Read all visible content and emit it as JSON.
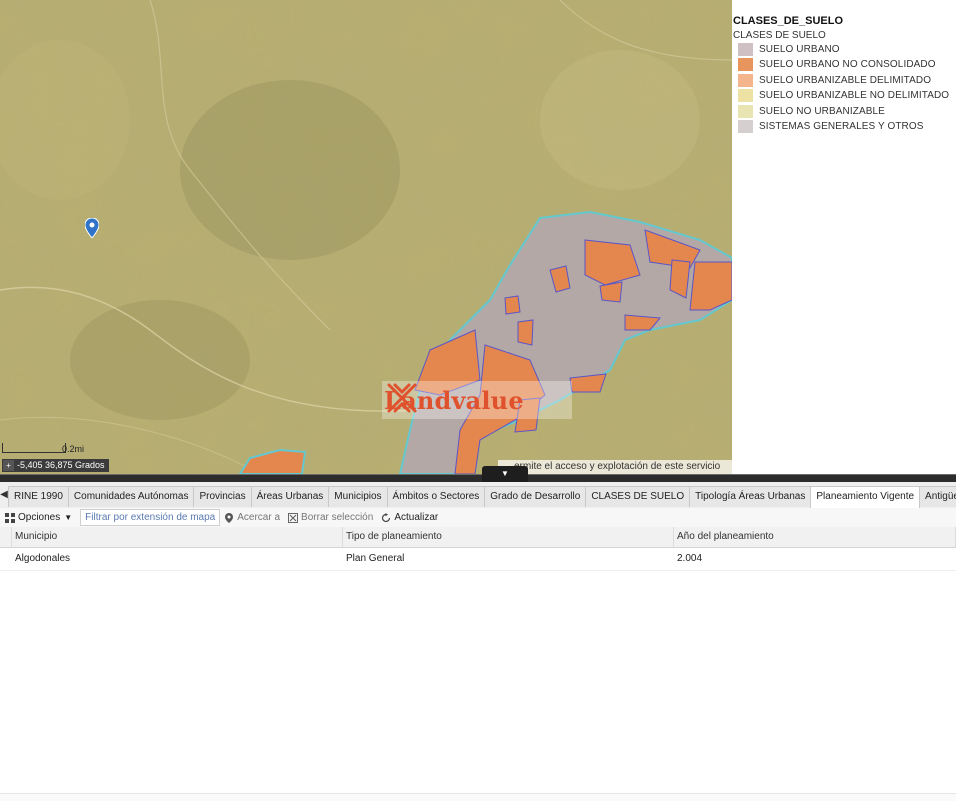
{
  "legend": {
    "title": "CLASES_DE_SUELO",
    "subtitle": "CLASES DE SUELO",
    "items": [
      {
        "label": "SUELO URBANO",
        "color": "#cfc0c4"
      },
      {
        "label": "SUELO URBANO NO CONSOLIDADO",
        "color": "#e8955d"
      },
      {
        "label": "SUELO URBANIZABLE DELIMITADO",
        "color": "#f4b48c"
      },
      {
        "label": "SUELO URBANIZABLE NO DELIMITADO",
        "color": "#ede1a4"
      },
      {
        "label": "SUELO NO URBANIZABLE",
        "color": "#e9e5b2"
      },
      {
        "label": "SISTEMAS GENERALES Y OTROS",
        "color": "#d6cfcf"
      }
    ]
  },
  "map": {
    "scale_label": "0.2mi",
    "coordinates": "-5,405 36,875 Grados",
    "attribution": "ermite el acceso y explotación de este servicio",
    "logo_text": "Landvalue",
    "colors": {
      "base": "#b5ab6c",
      "urban": "#b6a8a8",
      "orange": "#e08a55",
      "outline": "#64c8cf",
      "pin": "#2f74c9"
    }
  },
  "tabs": {
    "items": [
      {
        "label": "RINE 1990",
        "active": false
      },
      {
        "label": "Comunidades Autónomas",
        "active": false
      },
      {
        "label": "Provincias",
        "active": false
      },
      {
        "label": "Áreas Urbanas",
        "active": false
      },
      {
        "label": "Municipios",
        "active": false
      },
      {
        "label": "Ámbitos o Sectores",
        "active": false
      },
      {
        "label": "Grado de Desarrollo",
        "active": false
      },
      {
        "label": "CLASES DE SUELO",
        "active": false
      },
      {
        "label": "Tipología Áreas Urbanas",
        "active": false
      },
      {
        "label": "Planeamiento Vigente",
        "active": true
      },
      {
        "label": "Antigüedad Planeamiento",
        "active": false
      }
    ]
  },
  "toolbar": {
    "options_label": "Opciones",
    "filter_label": "Filtrar por extensión de mapa",
    "zoom_label": "Acercar a",
    "clear_label": "Borrar selección",
    "refresh_label": "Actualizar"
  },
  "table": {
    "columns": [
      "Municipio",
      "Tipo de planeamiento",
      "Año del planeamiento"
    ],
    "rows": [
      [
        "Algodonales",
        "Plan General",
        "2.004"
      ]
    ]
  }
}
